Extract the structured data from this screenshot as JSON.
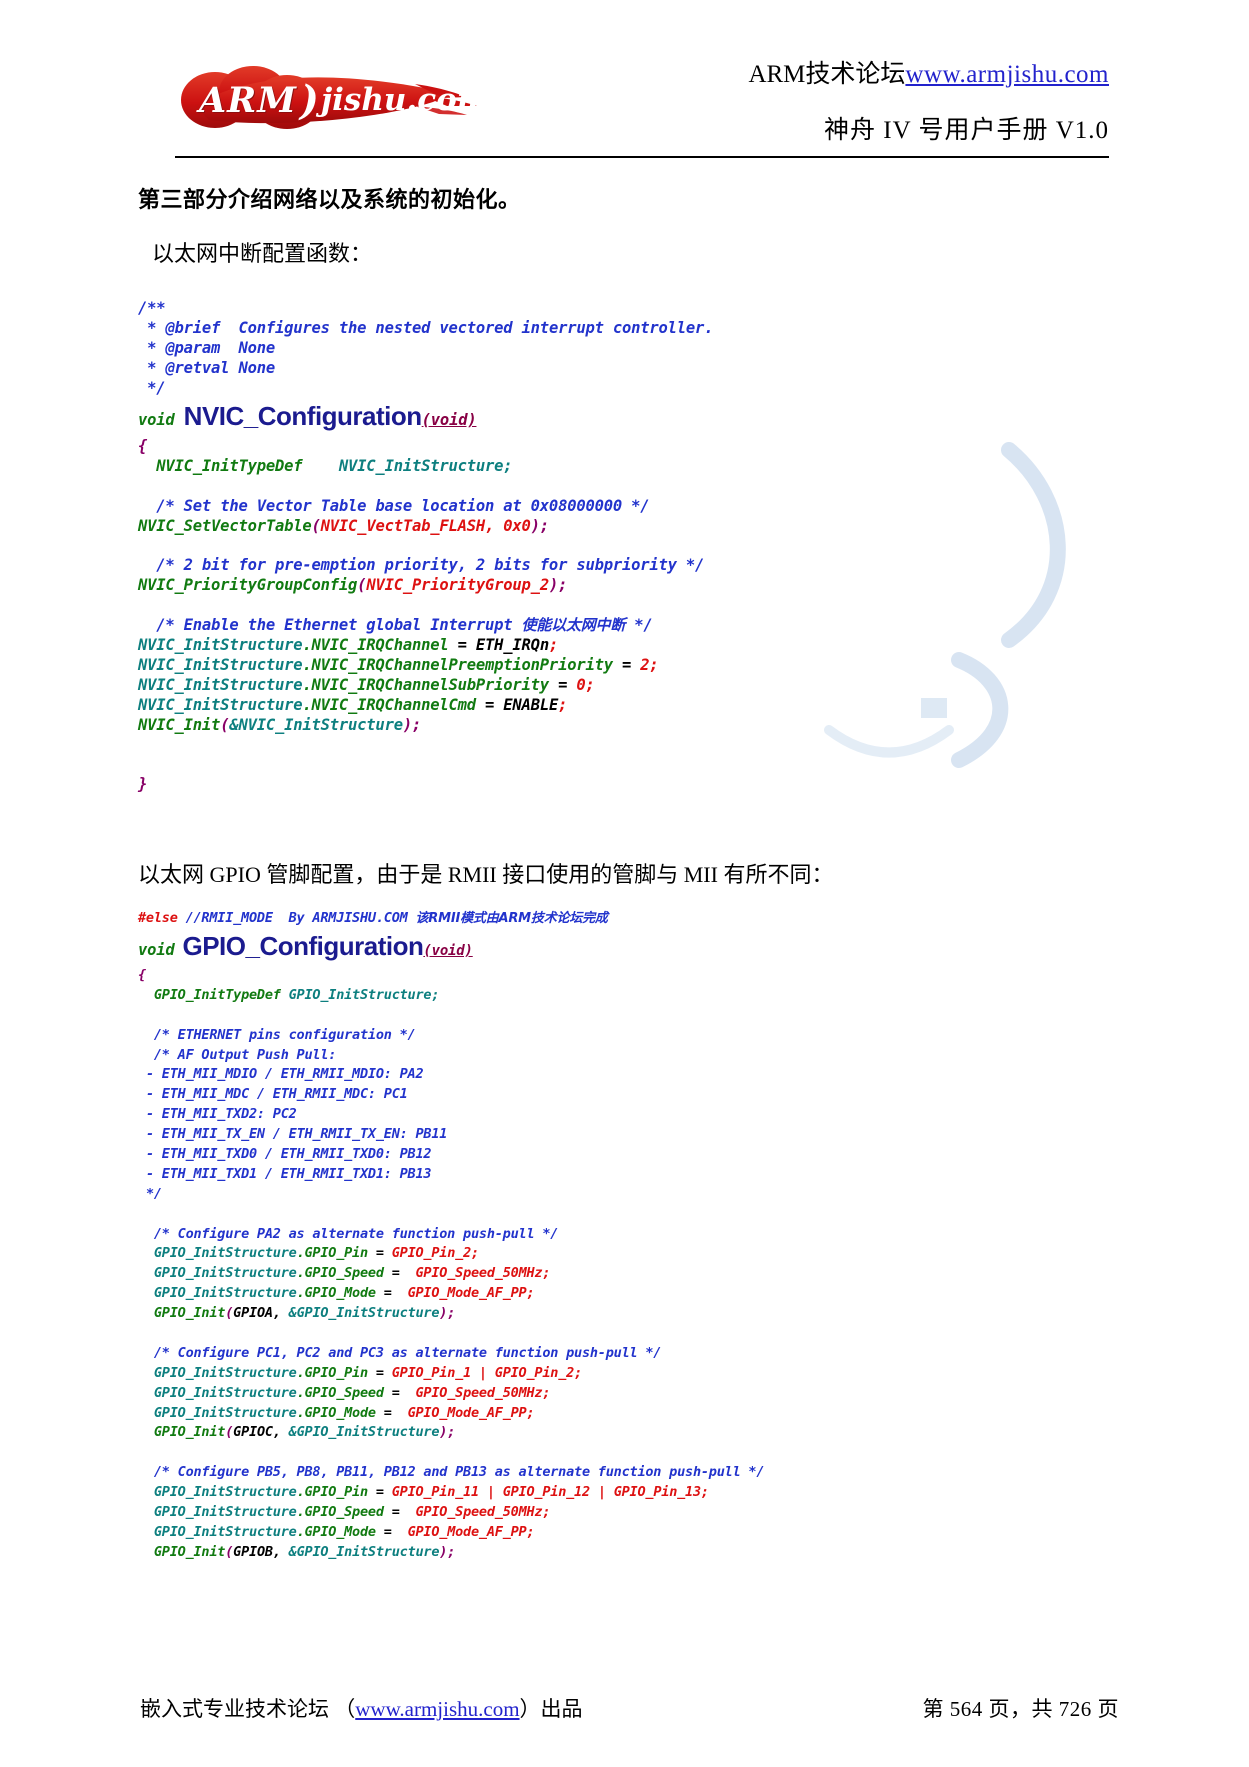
{
  "header": {
    "logo": {
      "arm": "ARM",
      "paren": ")",
      "jishu": "jishu.com",
      "brand_color": "#cc1111"
    },
    "line1_prefix": "ARM技术论坛",
    "line1_link": "www.armjishu.com",
    "line2": "神舟 IV 号用户手册 V1.0"
  },
  "body": {
    "section_title": "第三部分介绍网络以及系统的初始化。",
    "para1": "以太网中断配置函数：",
    "para2": "以太网 GPIO 管脚配置，由于是 RMII 接口使用的管脚与 MII 有所不同："
  },
  "code1": {
    "l01": "/**",
    "l02_star": " * ",
    "l02": "@brief  Configures the nested vectored interrupt controller.",
    "l03": " * @param  None",
    "l04": " * @retval None",
    "l05": " */",
    "l06_void": "void",
    "l06_name": "NVIC_Configuration",
    "l06_args": "(void)",
    "l07_brace": "{",
    "l08_type": "NVIC_InitTypeDef",
    "l08_var": "NVIC_InitStructure;",
    "l09_comment": "/* Set the Vector Table base location at 0x08000000 */",
    "l10_func": "NVIC_SetVectorTable",
    "l10_open": "(",
    "l10_arg1": "NVIC_VectTab_FLASH, 0x0",
    "l10_close": ");",
    "l11_comment": "/* 2 bit for pre-emption priority, 2 bits for subpriority */",
    "l12_func": "NVIC_PriorityGroupConfig",
    "l12_open": "(",
    "l12_arg1": "NVIC_PriorityGroup_2",
    "l12_close": ");",
    "l13_comment_en": "/* Enable the Ethernet global Interrupt ",
    "l13_comment_cn": "使能以太网中断",
    "l13_comment_end": " */",
    "l14_var": "NVIC_InitStructure",
    "l14_member": ".NVIC_IRQChannel",
    "l14_eq": " = ",
    "l14_val": "ETH_IRQn",
    "l14_semi": ";",
    "l15_var": "NVIC_InitStructure",
    "l15_member": ".NVIC_IRQChannelPreemptionPriority",
    "l15_eq": " = ",
    "l15_val": "2",
    "l15_semi": ";",
    "l16_var": "NVIC_InitStructure",
    "l16_member": ".NVIC_IRQChannelSubPriority",
    "l16_eq": " = ",
    "l16_val": "0",
    "l16_semi": ";",
    "l17_var": "NVIC_InitStructure",
    "l17_member": ".NVIC_IRQChannelCmd",
    "l17_eq": " = ",
    "l17_val": "ENABLE",
    "l17_semi": ";",
    "l18_func": "NVIC_Init",
    "l18_open": "(",
    "l18_arg": "&NVIC_InitStructure",
    "l18_close": ");",
    "l19_brace": "}"
  },
  "code2": {
    "l01_pre": "#else",
    "l01_comment": " //RMII_MODE  By ARMJISHU.COM ",
    "l01_cn": "该RMII模式由ARM技术论坛完成",
    "l02_void": "void",
    "l02_name": "GPIO_Configuration",
    "l02_args": "(void)",
    "l03_brace": "{",
    "l04_type": "GPIO_InitTypeDef",
    "l04_var": " GPIO_InitStructure;",
    "l05": "/* ETHERNET pins configuration */",
    "l06": "/* AF Output Push Pull:",
    "l07": "- ETH_MII_MDIO / ETH_RMII_MDIO: PA2",
    "l08": "- ETH_MII_MDC / ETH_RMII_MDC: PC1",
    "l09": "- ETH_MII_TXD2: PC2",
    "l10": "- ETH_MII_TX_EN / ETH_RMII_TX_EN: PB11",
    "l11": "- ETH_MII_TXD0 / ETH_RMII_TXD0: PB12",
    "l12": "- ETH_MII_TXD1 / ETH_RMII_TXD1: PB13",
    "l13": "*/",
    "l14_comment": "/* Configure PA2 as alternate function push-pull */",
    "l15_var": "GPIO_InitStructure",
    "l15_member": ".GPIO_Pin",
    "l15_eq": " = ",
    "l15_val": "GPIO_Pin_2",
    "l15_semi": ";",
    "l16_var": "GPIO_InitStructure",
    "l16_member": ".GPIO_Speed",
    "l16_eq": " = ",
    "l16_val": " GPIO_Speed_50MHz",
    "l16_semi": ";",
    "l17_var": "GPIO_InitStructure",
    "l17_member": ".GPIO_Mode",
    "l17_eq": " = ",
    "l17_val": " GPIO_Mode_AF_PP",
    "l17_semi": ";",
    "l18_func": "GPIO_Init",
    "l18_open": "(",
    "l18_a1": "GPIOA",
    "l18_mid": ", ",
    "l18_a2": "&GPIO_InitStructure",
    "l18_close": ");",
    "l19_comment": "/* Configure PC1, PC2 and PC3 as alternate function push-pull */",
    "l20_var": "GPIO_InitStructure",
    "l20_member": ".GPIO_Pin",
    "l20_eq": " = ",
    "l20_val": "GPIO_Pin_1 | GPIO_Pin_2",
    "l20_semi": ";",
    "l21_var": "GPIO_InitStructure",
    "l21_member": ".GPIO_Speed",
    "l21_eq": " = ",
    "l21_val": " GPIO_Speed_50MHz",
    "l21_semi": ";",
    "l22_var": "GPIO_InitStructure",
    "l22_member": ".GPIO_Mode",
    "l22_eq": " = ",
    "l22_val": " GPIO_Mode_AF_PP",
    "l22_semi": ";",
    "l23_func": "GPIO_Init",
    "l23_open": "(",
    "l23_a1": "GPIOC",
    "l23_mid": ", ",
    "l23_a2": "&GPIO_InitStructure",
    "l23_close": ");",
    "l24_comment": "/* Configure PB5, PB8, PB11, PB12 and PB13 as alternate function push-pull */",
    "l25_var": "GPIO_InitStructure",
    "l25_member": ".GPIO_Pin",
    "l25_eq": " = ",
    "l25_val": "GPIO_Pin_11 | GPIO_Pin_12 | GPIO_Pin_13",
    "l25_semi": ";",
    "l26_var": "GPIO_InitStructure",
    "l26_member": ".GPIO_Speed",
    "l26_eq": " = ",
    "l26_val": " GPIO_Speed_50MHz",
    "l26_semi": ";",
    "l27_var": "GPIO_InitStructure",
    "l27_member": ".GPIO_Mode",
    "l27_eq": " = ",
    "l27_val": " GPIO_Mode_AF_PP",
    "l27_semi": ";",
    "l28_func": "GPIO_Init",
    "l28_open": "(",
    "l28_a1": "GPIOB",
    "l28_mid": ", ",
    "l28_a2": "&GPIO_InitStructure",
    "l28_close": ");"
  },
  "footer": {
    "left_prefix": "嵌入式专业技术论坛 （",
    "left_link": "www.armjishu.com",
    "left_suffix": "）出品",
    "right": "第 564 页，共 726 页"
  }
}
